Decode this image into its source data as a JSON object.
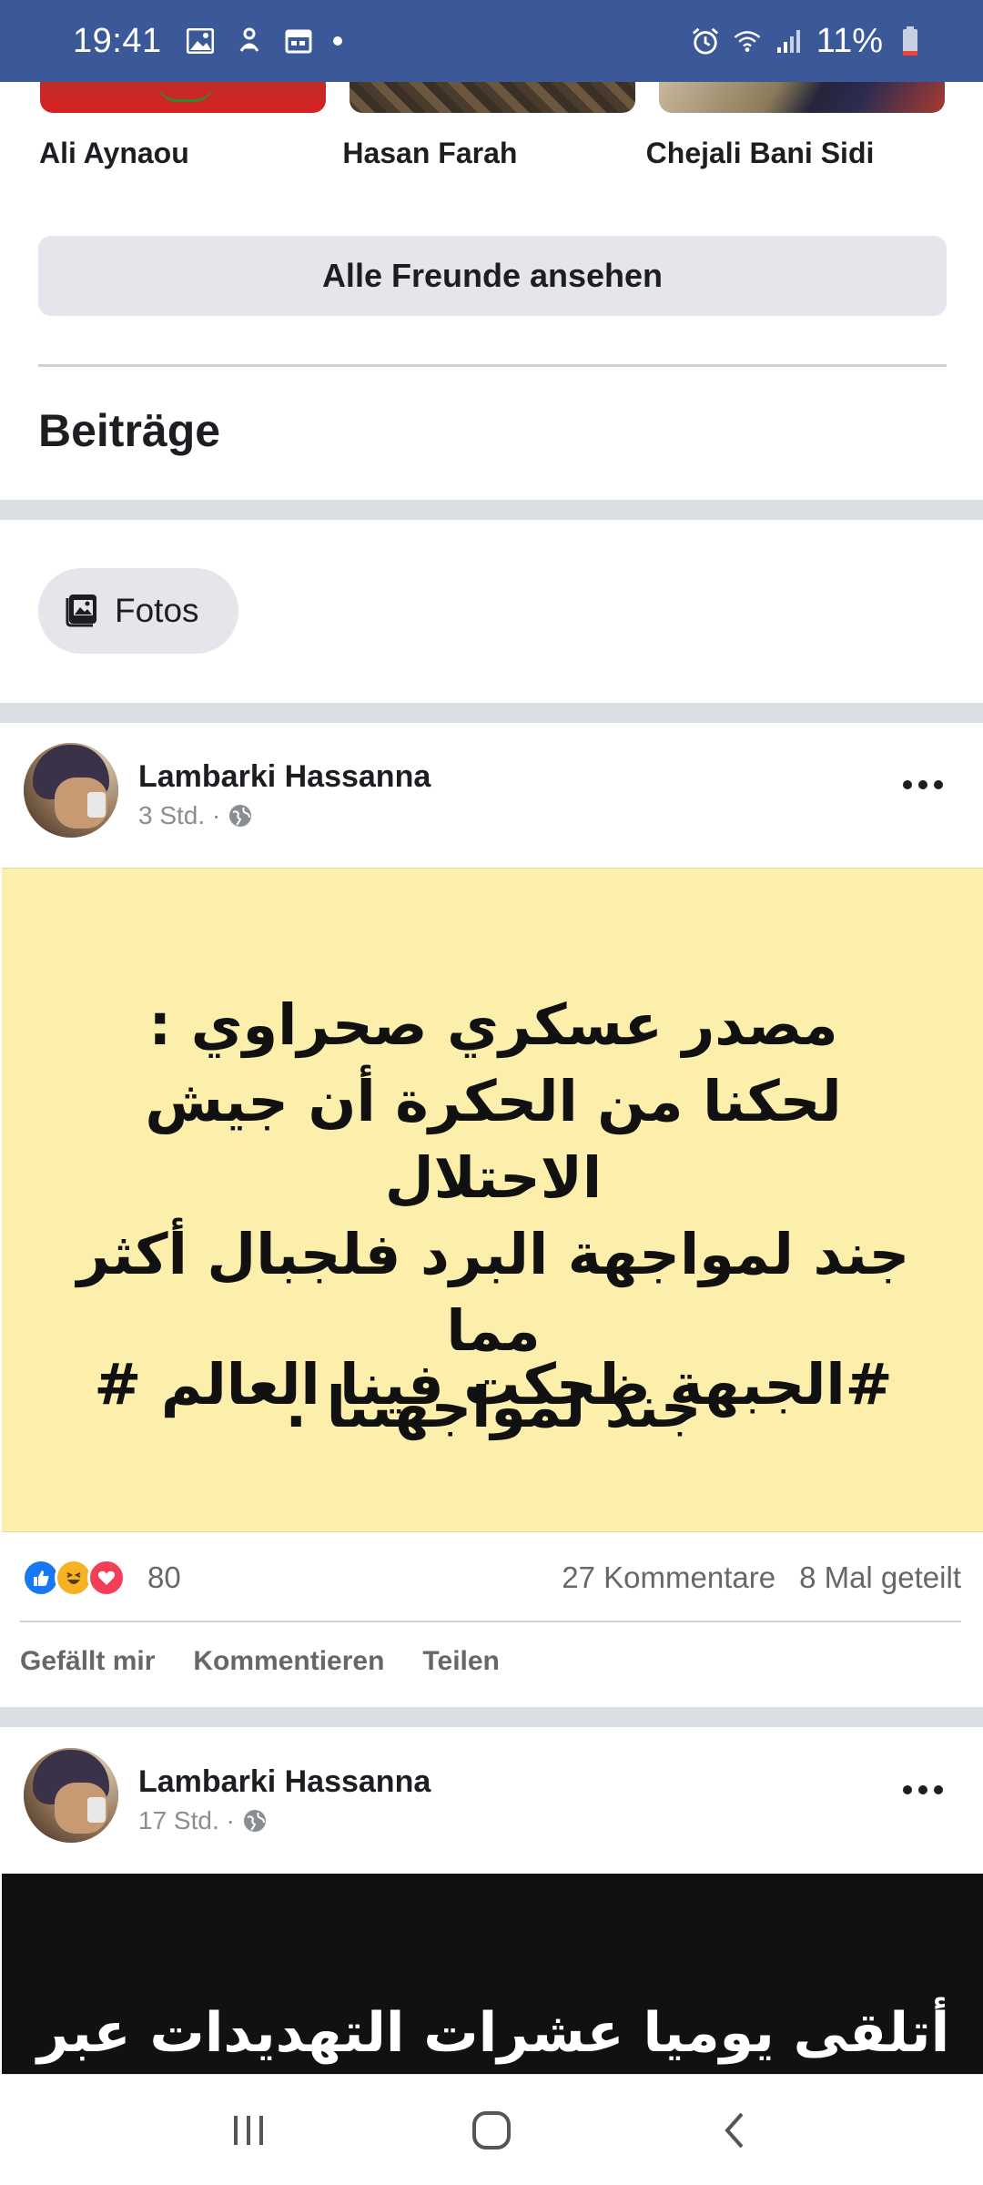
{
  "status_bar": {
    "time": "19:41",
    "battery": "11%",
    "left_icons": [
      "image-icon",
      "upload-icon",
      "calendar-icon",
      "notification-dot"
    ],
    "right_icons": [
      "alarm-icon",
      "wifi-icon",
      "signal-icon",
      "battery-icon"
    ],
    "color": "#3b5998"
  },
  "friends": {
    "items": [
      {
        "name": "Ali Aynaou"
      },
      {
        "name": "Hasan Farah"
      },
      {
        "name": "Chejali Bani Sidi"
      }
    ],
    "see_all_label": "Alle Freunde ansehen"
  },
  "posts_section": {
    "title": "Beiträge",
    "photos_chip_label": "Fotos"
  },
  "posts": [
    {
      "author": "Lambarki Hassanna",
      "time": "3 Std. ·",
      "visibility_icon": "globe-icon",
      "image_lines": [
        "مصدر عسكري صحراوي :",
        "لحكنا من الحكرة أن جيش الاحتلال",
        "جند لمواجهة البرد فلجبال أكثر مما",
        "جند لمواجهتنا ."
      ],
      "image_hashtag": "#الجبهة ظحكت فينا العالم #",
      "image_bg": "#fcefac",
      "reactions": [
        "like",
        "haha",
        "love"
      ],
      "reaction_count": "80",
      "comments": "27 Kommentare",
      "shares": "8 Mal geteilt",
      "actions": {
        "like": "Gefällt mir",
        "comment": "Kommentieren",
        "share": "Teilen"
      }
    },
    {
      "author": "Lambarki Hassanna",
      "time": "17 Std. ·",
      "visibility_icon": "globe-icon",
      "image_line": "أتلقى يوميا عشرات التهديدات  عبر",
      "image_bg": "#111111"
    }
  ],
  "nav_bar": {
    "buttons": [
      "recent-apps-icon",
      "home-icon",
      "back-icon"
    ]
  }
}
